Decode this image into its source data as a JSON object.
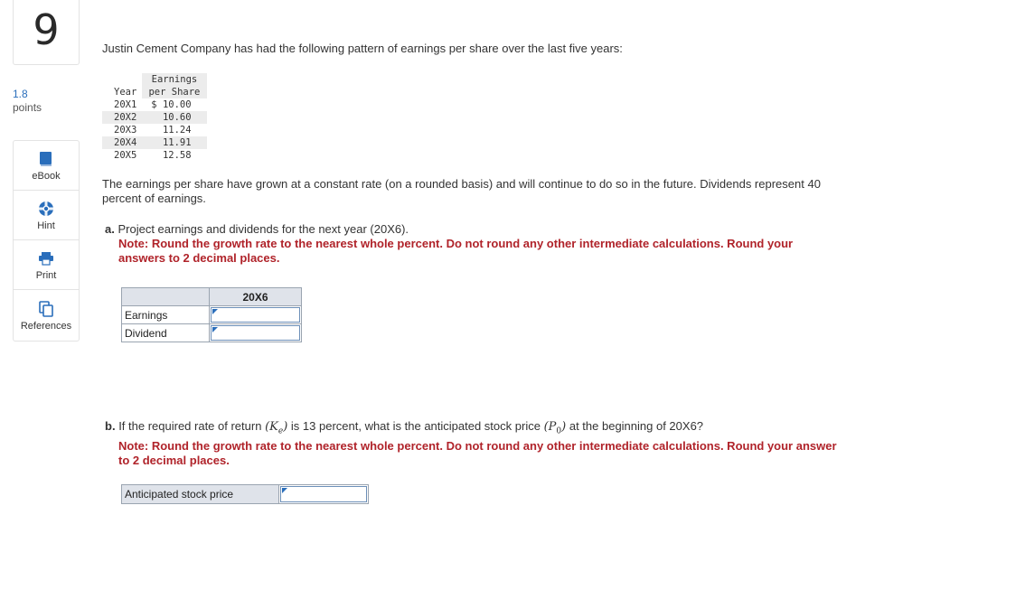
{
  "question_number": "9",
  "points": {
    "value": "1.8",
    "label": "points"
  },
  "tools": [
    {
      "label": "eBook",
      "icon": "book-icon"
    },
    {
      "label": "Hint",
      "icon": "lifebuoy-icon"
    },
    {
      "label": "Print",
      "icon": "printer-icon"
    },
    {
      "label": "References",
      "icon": "copy-icon"
    }
  ],
  "intro": "Justin Cement Company has had the following pattern of earnings per share over the last five years:",
  "eps_table": {
    "col1": "Year",
    "col2_line1": "Earnings",
    "col2_line2": "per Share",
    "rows": [
      {
        "year": "20X1",
        "value": "$ 10.00"
      },
      {
        "year": "20X2",
        "value": "10.60"
      },
      {
        "year": "20X3",
        "value": "11.24"
      },
      {
        "year": "20X4",
        "value": "11.91"
      },
      {
        "year": "20X5",
        "value": "12.58"
      }
    ]
  },
  "paragraph": "The earnings per share have grown at a constant rate (on a rounded basis) and will continue to do so in the future. Dividends represent 40 percent of earnings.",
  "part_a": {
    "letter": "a.",
    "text": "Project earnings and dividends for the next year (20X6).",
    "note": "Note: Round the growth rate to the nearest whole percent. Do not round any other intermediate calculations. Round your answers to 2 decimal places."
  },
  "answer_table": {
    "col_header": "20X6",
    "rows": [
      {
        "label": "Earnings",
        "value": ""
      },
      {
        "label": "Dividend",
        "value": ""
      }
    ]
  },
  "part_b": {
    "letter": "b.",
    "text_1": "If the required rate of return",
    "ke": "(Ke)",
    "text_2": "is 13 percent, what is the anticipated stock price",
    "p0": "(P0)",
    "text_3": "at the beginning of 20X6?",
    "note": "Note: Round the growth rate to the nearest whole percent. Do not round any other intermediate calculations. Round your answer to 2 decimal places."
  },
  "stock_row": {
    "label": "Anticipated stock price",
    "value": ""
  },
  "colors": {
    "note": "#b0232a",
    "accent": "#2a6ebb",
    "header_bg": "#dfe3ea"
  }
}
